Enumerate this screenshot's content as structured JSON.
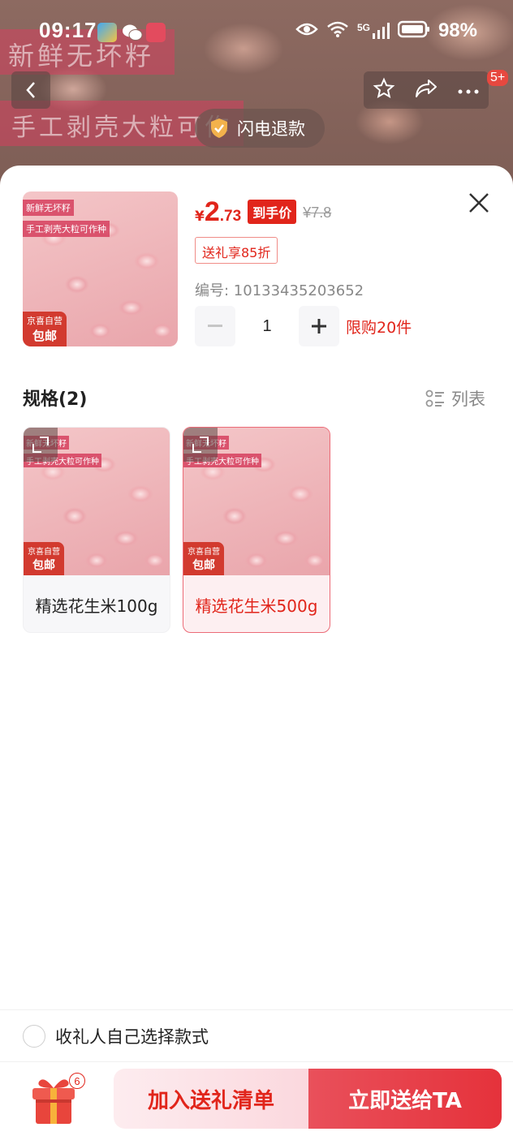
{
  "status_bar": {
    "time": "09:17",
    "network": "5G",
    "battery": "98%"
  },
  "background": {
    "banner_line1": "新鲜无坏籽",
    "banner_line2": "手工剥壳大粒可作",
    "refund_chip": "闪电退款",
    "cart_badge": "5+"
  },
  "product": {
    "thumb_tag1": "新鲜无坏籽",
    "thumb_tag2": "手工剥壳大粒可作种",
    "jd_badge_line1": "京喜自营",
    "jd_badge_line2": "包邮",
    "price_symbol": "¥",
    "price_integer": "2",
    "price_decimal": ".73",
    "price_tag": "到手价",
    "original_price": "¥7.8",
    "discount_tag": "送礼享85折",
    "sku_code": "编号: 10133435203652",
    "quantity": "1",
    "limit_text": "限购20件"
  },
  "specs": {
    "title": "规格(2)",
    "list_toggle": "列表",
    "items": [
      {
        "label": "精选花生米100g",
        "selected": false
      },
      {
        "label": "精选花生米500g",
        "selected": true
      }
    ]
  },
  "recipient_option": "收礼人自己选择款式",
  "bottom_bar": {
    "gift_count": "6",
    "add_button": "加入送礼清单",
    "send_button": "立即送给TA"
  },
  "colors": {
    "accent_red": "#e1251b",
    "selected_border": "#ec6b77",
    "selected_bg": "#fdeff1"
  }
}
